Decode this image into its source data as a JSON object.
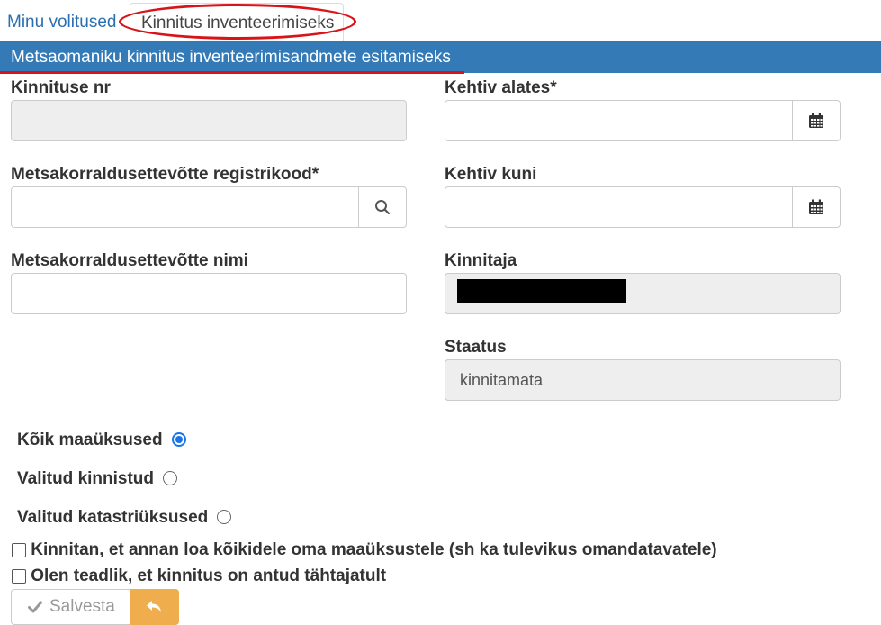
{
  "tabs": {
    "my_mandates": "Minu volitused",
    "confirmation": "Kinnitus inventeerimiseks"
  },
  "header": {
    "title": "Metsaomaniku kinnitus inventeerimisandmete esitamiseks"
  },
  "form": {
    "confirmation_number": {
      "label": "Kinnituse nr",
      "value": ""
    },
    "valid_from": {
      "label": "Kehtiv alates*",
      "value": ""
    },
    "registry_code": {
      "label": "Metsakorraldusettevõtte registrikood*",
      "value": ""
    },
    "valid_until": {
      "label": "Kehtiv kuni",
      "value": ""
    },
    "company_name": {
      "label": "Metsakorraldusettevõtte nimi",
      "value": ""
    },
    "confirmer": {
      "label": "Kinnitaja"
    },
    "status": {
      "label": "Staatus",
      "value": "kinnitamata"
    }
  },
  "scope_options": [
    {
      "label": "Kõik maaüksused",
      "selected": true
    },
    {
      "label": "Valitud kinnistud",
      "selected": false
    },
    {
      "label": "Valitud katastriüksused",
      "selected": false
    }
  ],
  "checkboxes": [
    {
      "label": "Kinnitan, et annan loa kõikidele oma maaüksustele (sh ka tulevikus omandatavatele)",
      "checked": false
    },
    {
      "label": "Olen teadlik, et kinnitus on antud tähtajatult",
      "checked": false
    }
  ],
  "buttons": {
    "save": "Salvesta"
  },
  "colors": {
    "header_bg": "#337ab7",
    "link": "#2a6fb0",
    "annotation_red": "#d8141a",
    "undo_button": "#f0ad4e",
    "radio_selected": "#1a73e8"
  },
  "icons": {
    "calendar": "calendar-icon",
    "search": "search-icon",
    "check": "check-icon",
    "undo": "undo-icon"
  }
}
